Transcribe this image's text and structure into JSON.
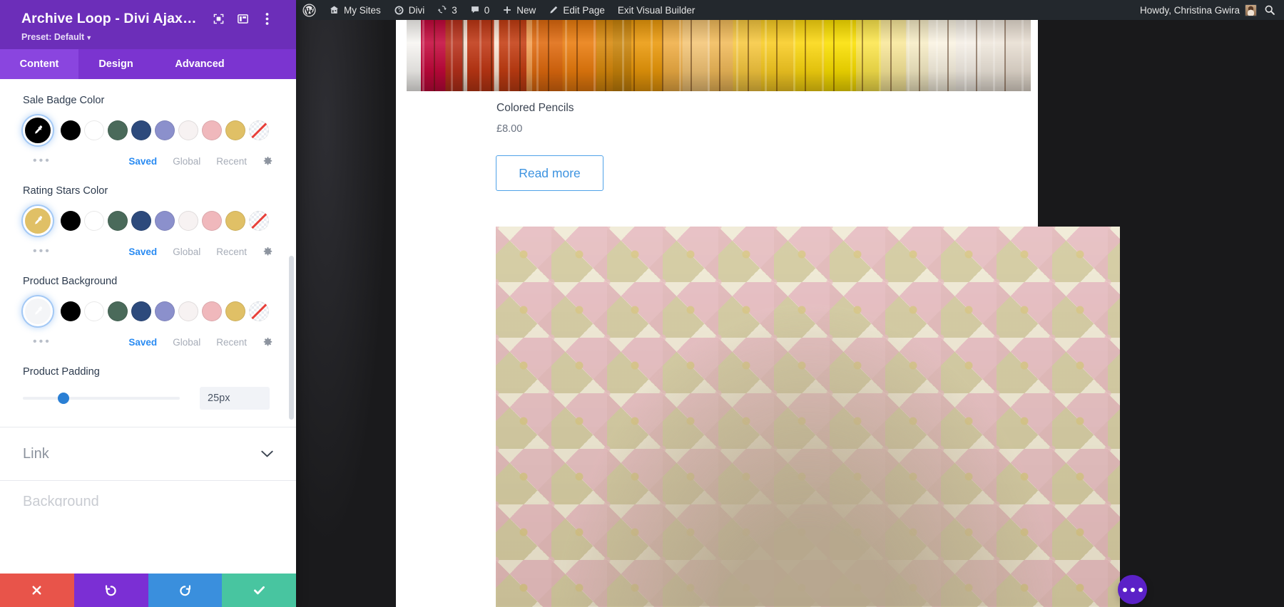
{
  "admin_bar": {
    "items": [
      {
        "icon": "wordpress-logo-icon",
        "label": ""
      },
      {
        "icon": "my-sites-icon",
        "label": "My Sites"
      },
      {
        "icon": "divi-icon",
        "label": "Divi"
      },
      {
        "icon": "updates-icon",
        "label": "3"
      },
      {
        "icon": "comments-icon",
        "label": "0"
      },
      {
        "icon": "plus-icon",
        "label": "New"
      },
      {
        "icon": "pencil-icon",
        "label": "Edit Page"
      },
      {
        "icon": "",
        "label": "Exit Visual Builder"
      }
    ],
    "howdy": "Howdy, Christina Gwira",
    "search_icon": "search-icon",
    "background": "#23282d"
  },
  "panel": {
    "title": "Archive Loop - Divi Ajax Filt...",
    "preset_label": "Preset: Default",
    "header_icons": [
      "target-focus-icon",
      "layout-columns-icon",
      "kebab-menu-icon"
    ],
    "tabs": [
      {
        "label": "Content",
        "active": true
      },
      {
        "label": "Design",
        "active": false
      },
      {
        "label": "Advanced",
        "active": false
      }
    ],
    "accent": "#6c2eb9",
    "fields": [
      {
        "label": "Sale Badge Color",
        "selected_color": "#000000",
        "palette": [
          "#000000",
          "#ffffff",
          "#4a6a5a",
          "#2d4a7c",
          "#8b90cc",
          "#f7f2f2",
          "#f0b8bc",
          "#e0c066"
        ],
        "has_none_swatch": true,
        "more_dots": "•••",
        "meta_links": [
          {
            "label": "Saved",
            "active": true
          },
          {
            "label": "Global",
            "active": false
          },
          {
            "label": "Recent",
            "active": false
          }
        ],
        "settings_icon": "gear-icon"
      },
      {
        "label": "Rating Stars Color",
        "selected_color": "#e0c066",
        "palette": [
          "#000000",
          "#ffffff",
          "#4a6a5a",
          "#2d4a7c",
          "#8b90cc",
          "#f7f2f2",
          "#f0b8bc",
          "#e0c066"
        ],
        "has_none_swatch": true,
        "more_dots": "•••",
        "meta_links": [
          {
            "label": "Saved",
            "active": true
          },
          {
            "label": "Global",
            "active": false
          },
          {
            "label": "Recent",
            "active": false
          }
        ],
        "settings_icon": "gear-icon"
      },
      {
        "label": "Product Background",
        "selected_color": "#f4f5f7",
        "palette": [
          "#000000",
          "#ffffff",
          "#4a6a5a",
          "#2d4a7c",
          "#8b90cc",
          "#f7f2f2",
          "#f0b8bc",
          "#e0c066"
        ],
        "has_none_swatch": true,
        "more_dots": "•••",
        "meta_links": [
          {
            "label": "Saved",
            "active": true
          },
          {
            "label": "Global",
            "active": false
          },
          {
            "label": "Recent",
            "active": false
          }
        ],
        "settings_icon": "gear-icon"
      }
    ],
    "slider_field": {
      "label": "Product Padding",
      "value": "25px",
      "knob_percent": 26
    },
    "accordions": [
      {
        "label": "Link",
        "caret": "chevron-down-icon"
      },
      {
        "label": "Background",
        "caret": "chevron-down-icon"
      }
    ],
    "actions": [
      {
        "name": "discard",
        "icon": "close-x-icon",
        "color": "#e8544a"
      },
      {
        "name": "undo",
        "icon": "undo-icon",
        "color": "#7b2fd4"
      },
      {
        "name": "redo",
        "icon": "redo-icon",
        "color": "#3a8fdd"
      },
      {
        "name": "save",
        "icon": "check-icon",
        "color": "#48c5a0"
      }
    ]
  },
  "canvas": {
    "product": {
      "image_alt": "colored-pencils-photo",
      "title": "Colored Pencils",
      "price": "£8.00",
      "button_label": "Read more"
    },
    "second_image_alt": "patterned-fabric-photo",
    "fab": {
      "icon": "ellipsis-icon",
      "color": "#5b21c7"
    }
  }
}
